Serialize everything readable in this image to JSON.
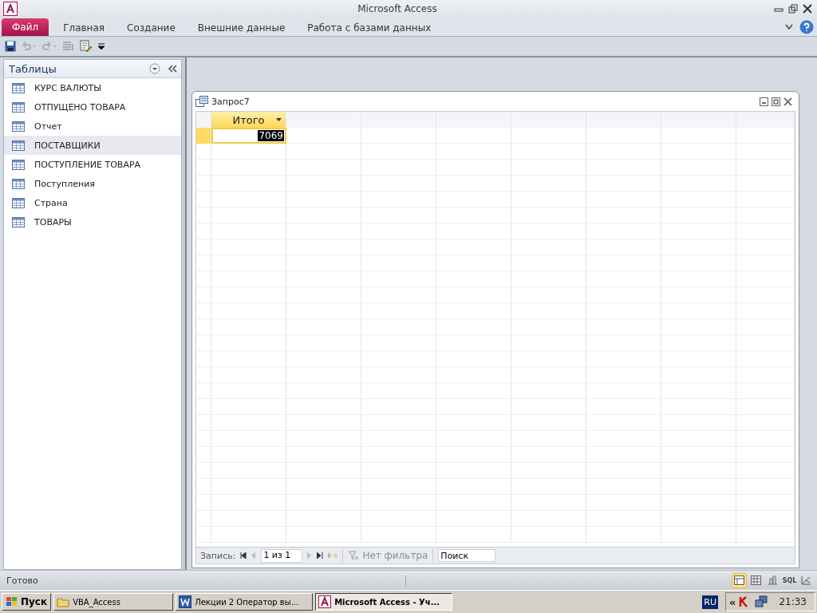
{
  "window": {
    "title": "Microsoft Access"
  },
  "ribbon_tabs": [
    {
      "label": "Файл",
      "selected": true,
      "kind": "file"
    },
    {
      "label": "Главная",
      "selected": false,
      "kind": "tab"
    },
    {
      "label": "Создание",
      "selected": false,
      "kind": "tab"
    },
    {
      "label": "Внешние данные",
      "selected": false,
      "kind": "tab"
    },
    {
      "label": "Работа с базами данных",
      "selected": false,
      "kind": "tab"
    }
  ],
  "nav_pane": {
    "title": "Таблицы",
    "items": [
      {
        "label": "КУРС ВАЛЮТЫ",
        "selected": false
      },
      {
        "label": "ОТПУЩЕНО ТОВАРА",
        "selected": false
      },
      {
        "label": "Отчет",
        "selected": false
      },
      {
        "label": "ПОСТАВЩИКИ",
        "selected": true
      },
      {
        "label": "ПОСТУПЛЕНИЕ ТОВАРА",
        "selected": false
      },
      {
        "label": "Поступления",
        "selected": false
      },
      {
        "label": "Страна",
        "selected": false
      },
      {
        "label": "ТОВАРЫ",
        "selected": false
      }
    ]
  },
  "query_window": {
    "title": "Запрос7",
    "columns": [
      {
        "label": "Итого",
        "selected": true
      }
    ],
    "rows": [
      {
        "cells": [
          "7069"
        ],
        "selected": true
      }
    ],
    "record_nav": {
      "label": "Запись:",
      "position": "1 из 1",
      "filter": "Нет фильтра",
      "search_placeholder": "Поиск"
    }
  },
  "status_bar": {
    "text": "Готово",
    "views": [
      {
        "kind": "datasheet",
        "selected": true
      },
      {
        "kind": "pivot-table",
        "selected": false
      },
      {
        "kind": "pivot-chart",
        "selected": false
      },
      {
        "kind": "sql",
        "label": "SQL",
        "selected": false
      },
      {
        "kind": "design",
        "selected": false
      }
    ]
  },
  "taskbar": {
    "start": "Пуск",
    "tasks": [
      {
        "label": "VBA_Access",
        "kind": "folder",
        "selected": false
      },
      {
        "label": "Лекции 2 Оператор вы...",
        "kind": "word",
        "selected": false
      },
      {
        "label": "Microsoft Access - Уч...",
        "kind": "access",
        "selected": true
      }
    ],
    "language": "RU",
    "tray_expand": "«",
    "clock": "21:33"
  }
}
